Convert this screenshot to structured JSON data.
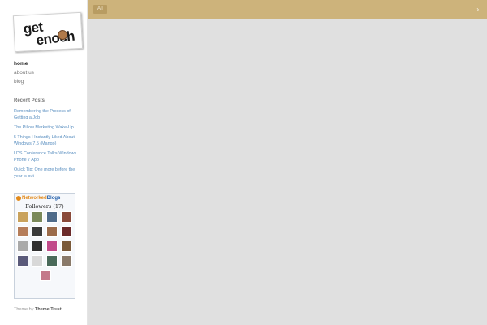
{
  "brand": {
    "logo_line1": "get",
    "logo_line2": "enoch"
  },
  "nav": {
    "items": [
      "home",
      "about us",
      "blog"
    ],
    "active": "home"
  },
  "recent_posts": {
    "title": "Recent Posts",
    "items": [
      "Remembering the Process of Getting a Job",
      "The Pillow Marketing Wake-Up",
      "5 Things I Instantly Liked About Windows 7.5 (Mango)",
      "LDS Conference Talks-Windows Phone 7 App",
      "Quick Tip: One more before the year is out"
    ]
  },
  "networked_blogs": {
    "brand_prefix": "Networked",
    "brand_suffix": "Blogs",
    "followers_label": "Followers (17)",
    "avatar_colors": [
      "#c9a25c",
      "#7b8a5a",
      "#4f6b8a",
      "#8a4a3a",
      "#b57d5a",
      "#3a3a3a",
      "#9b6b4a",
      "#6a2a2a",
      "#a9a9a9",
      "#2f2f2f",
      "#c14a8a",
      "#7a5a3a",
      "#5a5a7a",
      "#d8d8d8",
      "#4a6a5a",
      "#8a7a6a",
      "#c47a8a"
    ]
  },
  "topbar": {
    "filter_label": "All",
    "toggle_icon": "chevron-right-icon"
  },
  "footer": {
    "prefix": "Theme by ",
    "author": "Theme Trust"
  },
  "colors": {
    "topbar": "#cdb37b",
    "main_bg": "#e0e0e0",
    "link": "#5a8fc0"
  }
}
